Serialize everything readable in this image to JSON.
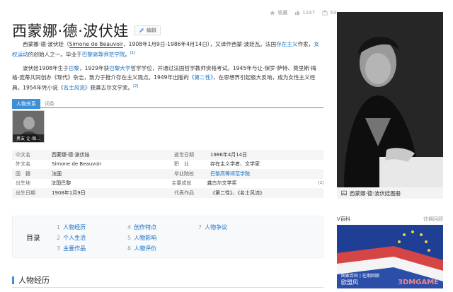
{
  "topbar": {
    "collect_label": "收藏",
    "likes": "1247",
    "shares": "53"
  },
  "title": "西蒙娜·德·波伏娃",
  "edit_label": "编辑",
  "intro": {
    "line1a": "西蒙娜·德·波伏娃（",
    "line1b": "Simone de Beauvoir",
    "line1c": "，1908年1月9日-1986年4月14日），又译作西蒙·波娃瓦。法国",
    "line1d": "存在主义",
    "line1e": "作家，",
    "line1f": "女权运动",
    "line1g": "的创始人之一。毕业于",
    "line1h": "巴黎高等师范学院",
    "line1i": "。",
    "ref1": "[1]"
  },
  "bio": {
    "p1": "波伏娃1908年生于",
    "p2": "巴黎",
    "p3": "，1929年获",
    "p4": "巴黎大学",
    "p5": "哲学学位，并通过法国哲学教师资格考试。1945年与让-保罗·萨特、莫里斯·梅格-庞蒂共同创办《现代》杂志，致力于推介存在主义观点。1949年出版的",
    "p6": "《第二性》",
    "p7": "，在思想界引起极大反响，成为女性主义经典。1954年凭小说",
    "p8": "《名士风流》",
    "p9": "获龚古尔文学奖。",
    "ref2": "[2]"
  },
  "tabs": {
    "active": "人物关系",
    "other": "词条"
  },
  "relation": {
    "label": "男友 让-保..."
  },
  "info_left": [
    {
      "k": "中文名",
      "v": "西蒙娜·德·波伏娃",
      "link": false
    },
    {
      "k": "外文名",
      "v": "Simone de Beauvoir",
      "link": false
    },
    {
      "k": "国　籍",
      "v": "法国",
      "link": false
    },
    {
      "k": "出生地",
      "v": "法国巴黎",
      "link": false
    },
    {
      "k": "出生日期",
      "v": "1908年1月9日",
      "link": false
    }
  ],
  "info_right": [
    {
      "k": "逝世日期",
      "v": "1986年4月14日",
      "link": false
    },
    {
      "k": "职　业",
      "v": "存在主义学者、文学家",
      "link": false
    },
    {
      "k": "毕业院校",
      "v": "巴黎高等师范学院",
      "link": true
    },
    {
      "k": "主要成就",
      "v": "龚古尔文学奖",
      "link": false,
      "ref": "[2]"
    },
    {
      "k": "代表作品",
      "v": "《第二性》、《名士风流》",
      "link": false
    }
  ],
  "toc": {
    "title": "目录",
    "items": [
      {
        "n": "1",
        "label": "人物经历"
      },
      {
        "n": "2",
        "label": "个人生活"
      },
      {
        "n": "3",
        "label": "主要作品"
      },
      {
        "n": "4",
        "label": "创作特点"
      },
      {
        "n": "5",
        "label": "人物影响"
      },
      {
        "n": "6",
        "label": "人物评价"
      },
      {
        "n": "7",
        "label": "人物争议"
      }
    ]
  },
  "section_title": "人物经历",
  "photo_caption": "西蒙娜·德·波伏娃图册",
  "vbaike": {
    "title": "V百科",
    "more": "往期回顾"
  },
  "promo": {
    "cap1": "国家百科 | 往期回顾",
    "cap2": "欧盟风"
  },
  "watermark": "3DMGAME",
  "colors": {
    "accent": "#3d8fd6",
    "link": "#136ec2"
  }
}
